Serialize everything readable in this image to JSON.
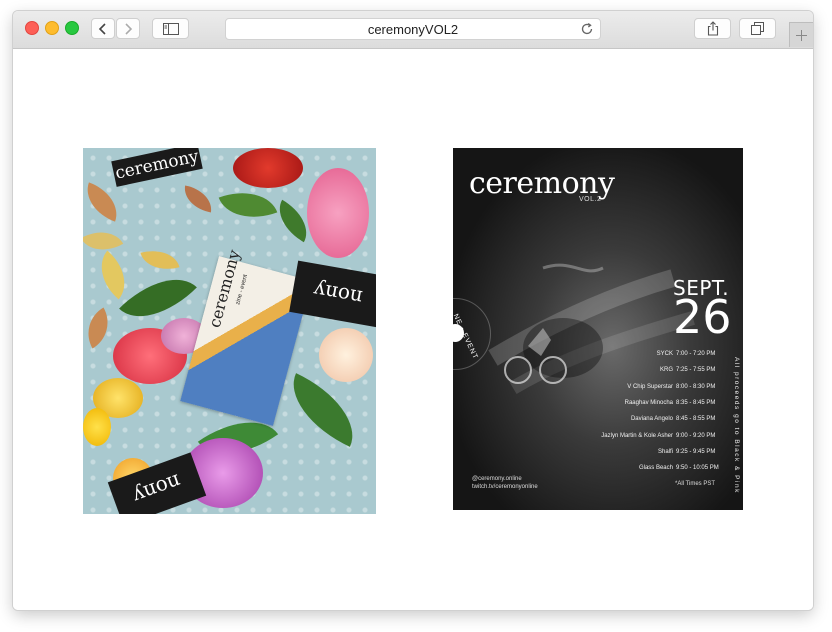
{
  "browser": {
    "page_title": "ceremonyVOL2",
    "icons": {
      "back": "chevron-left-icon",
      "forward": "chevron-right-icon",
      "sidebar": "sidebar-icon",
      "reload": "reload-icon",
      "share": "share-icon",
      "tabs": "tabs-icon",
      "new_tab": "plus-icon"
    },
    "colors": {
      "close": "#fd5f57",
      "minimize": "#febc2e",
      "zoom": "#28c840"
    }
  },
  "photo1": {
    "labels": [
      "ceremony",
      "nony",
      "nony"
    ],
    "zine_text": "ceremony",
    "zine_sub": "zine - event"
  },
  "poster": {
    "brand": "ceremony",
    "vol": "VOL.2",
    "month": "SEPT.",
    "day": "26",
    "ring_text": "NE • EVENT",
    "schedule": [
      {
        "name": "SYCK",
        "time": "7:00 - 7:20 PM"
      },
      {
        "name": "KRG",
        "time": "7:25 - 7:55 PM"
      },
      {
        "name": "V Chip Superstar",
        "time": "8:00 - 8:30 PM"
      },
      {
        "name": "Raaghav Minocha",
        "time": "8:35 - 8:45 PM"
      },
      {
        "name": "Daviana Angelo",
        "time": "8:45 - 8:55 PM"
      },
      {
        "name": "Jazlyn Martin & Kole Asher",
        "time": "9:00 - 9:20 PM"
      },
      {
        "name": "Shalfi",
        "time": "9:25 - 9:45 PM"
      },
      {
        "name": "Glass Beach",
        "time": "9:50 - 10:05 PM"
      }
    ],
    "proceeds": "All proceeds go to Black & Pink",
    "handle": "@ceremony.online",
    "twitch": "twitch.tv/ceremonyonline",
    "timezone": "*All Times PST"
  }
}
